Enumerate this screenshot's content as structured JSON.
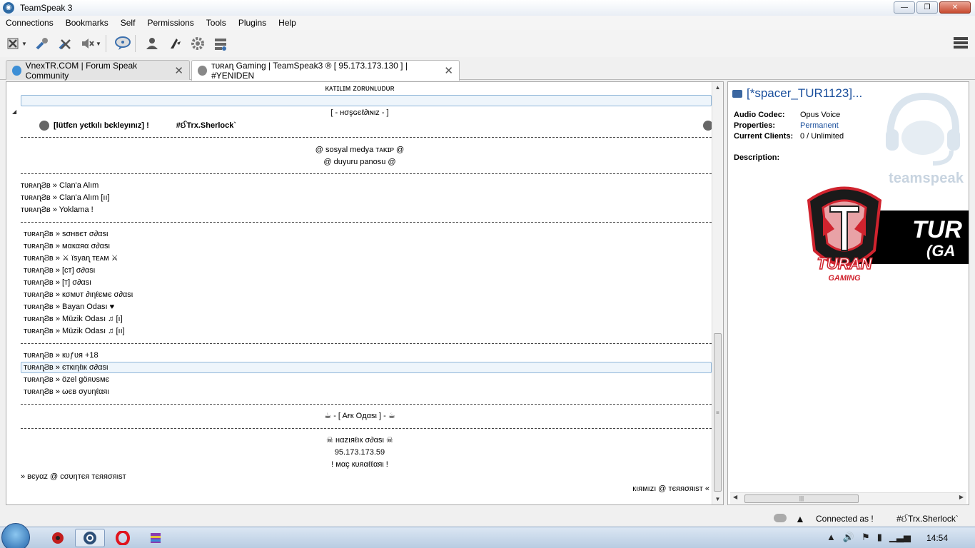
{
  "window": {
    "title": "TeamSpeak 3"
  },
  "menu": [
    "Connections",
    "Bookmarks",
    "Self",
    "Permissions",
    "Tools",
    "Plugins",
    "Help"
  ],
  "toolbar": {
    "buttons": [
      "disconnect-icon",
      "mute-microphone-icon",
      "mute-speakers-icon",
      "speaker-volume-icon",
      "chat-bubble-icon",
      "contacts-icon",
      "away-icon",
      "settings-gear-icon",
      "server-info-icon"
    ],
    "right_button": "layout-icon"
  },
  "tabs": [
    {
      "label": "VnexTR.COM | Forum Speak Community"
    },
    {
      "label": "ᴛᴜʀᴀɳ Gaming | TeamSpeak3 ® [ 95.173.173.130 ] | #YENIDEN"
    }
  ],
  "tree": {
    "items": {
      "katilim": "ᴋᴀᴛɪʟɪᴍ ᴢᴏʀᴜɴʟᴜᴅᴜʀ",
      "hosgeldiniz": "[ - нσşɢєℓ∂ιɴιz - ]",
      "user_left": "[lütfєn yєtkılı bєkleyınız] !",
      "user_right": "#ઈTrx.Sherlock`",
      "sosyal": "@ sosyal medya ᴛᴀᴋɪᴘ @",
      "duyuru": "@ duyuru panosu @",
      "clan1": "ᴛᴜʀᴀɳϨʙ » Clan'a Alım",
      "clan2": "ᴛᴜʀᴀɳϨʙ » Clan'a Alım [ıı]",
      "yoklama": "ᴛᴜʀᴀɳϨʙ » Yoklama !",
      "sohbet": "ᴛᴜʀᴀɳϨʙ » ѕσнвєт σ∂αѕι",
      "makara": "ᴛᴜʀᴀɳϨʙ » мαкαяα σ∂αѕι",
      "isyan": "ᴛᴜʀᴀɳϨʙ » ⚔ ïsyaɳ ᴛᴇᴀᴍ ⚔",
      "ct": "ᴛᴜʀᴀɳϨʙ » [ᴄᴛ] σ∂αѕι",
      "t": "ᴛᴜʀᴀɳϨʙ » [ᴛ] σ∂αѕι",
      "komut": "ᴛᴜʀᴀɳϨʙ » кσмυт ∂ιηℓємє σ∂αѕι",
      "bayan": "ᴛᴜʀᴀɳϨʙ » Bayan Odası ♥",
      "muzik1": "ᴛᴜʀᴀɳϨʙ »  Müzik Odası ♫ [ı]",
      "muzik2": "ᴛᴜʀᴀɳϨʙ »  Müzik Odası ♫ [ıı]",
      "kufur": "ᴛᴜʀᴀɳϨʙ » кυƒυя +18",
      "etkinlik": "ᴛᴜʀᴀɳϨʙ » єткιηℓιк σ∂αѕι",
      "ozel": "ᴛᴜʀᴀɳϨʙ » özel göяυѕмє",
      "web": "ᴛᴜʀᴀɳϨʙ » ωєв σуυηℓαяι",
      "afk": "☕ - [ Aғк Oдαѕι ] - ☕",
      "hazirlik": "☠ нαzıяℓıк σ∂αѕι ☠",
      "ip": "95.173.173.59",
      "mac": "! мαç кυяαℓℓαяι !",
      "beyaz": "» вєуαz @ ᴄσυηтєя тєяяσяιѕт",
      "kirmizi": "кıямızı @ тєяяσяιѕт «"
    }
  },
  "info": {
    "title": "[*spacer_TUR1123]...",
    "audio_codec_label": "Audio Codec:",
    "audio_codec_value": "Opus Voice",
    "properties_label": "Properties:",
    "properties_value": "Permanent",
    "clients_label": "Current Clients:",
    "clients_value": "0 / Unlimited",
    "description_label": "Description:",
    "logo_word": "teamspeak",
    "banner_big": "TUR",
    "banner_small": "(GA",
    "banner_shield_text1": "TURAN",
    "banner_shield_text2": "GAMING"
  },
  "status": {
    "connected": "Connected as !",
    "nickname": "#ઈTrx.Sherlock`"
  },
  "taskbar": {
    "clock": "14:54"
  },
  "colors": {
    "link": "#1a4f9c",
    "highlight_border": "#90b6d9",
    "banner_red": "#d0232e"
  }
}
